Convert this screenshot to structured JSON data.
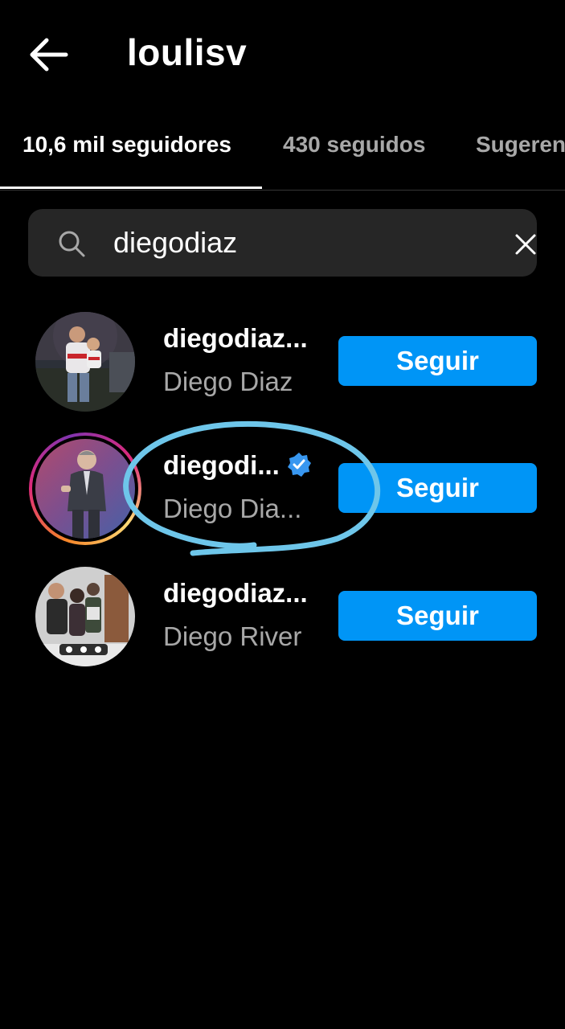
{
  "header": {
    "back_icon": "arrow-left-icon",
    "title": "loulisv"
  },
  "tabs": [
    {
      "label": "10,6 mil seguidores",
      "active": true
    },
    {
      "label": "430 seguidos",
      "active": false
    },
    {
      "label": "Sugerencias",
      "active": false
    }
  ],
  "search": {
    "icon": "search-icon",
    "value": "diegodiaz",
    "clear_icon": "close-icon"
  },
  "results": [
    {
      "username": "diegodiaz...",
      "full_name": "Diego Diaz",
      "verified": false,
      "has_story": false,
      "button": "Seguir"
    },
    {
      "username": "diegodi...",
      "full_name": "Diego Dia...",
      "verified": true,
      "has_story": true,
      "button": "Seguir"
    },
    {
      "username": "diegodiaz...",
      "full_name": "Diego River",
      "verified": false,
      "has_story": false,
      "button": "Seguir"
    }
  ],
  "colors": {
    "background": "#000000",
    "follow_button": "#0095f6",
    "search_field": "#262626",
    "secondary_text": "#a8a8a8",
    "verified_badge": "#3897f0",
    "annotation_stroke": "#6ec6ea"
  }
}
